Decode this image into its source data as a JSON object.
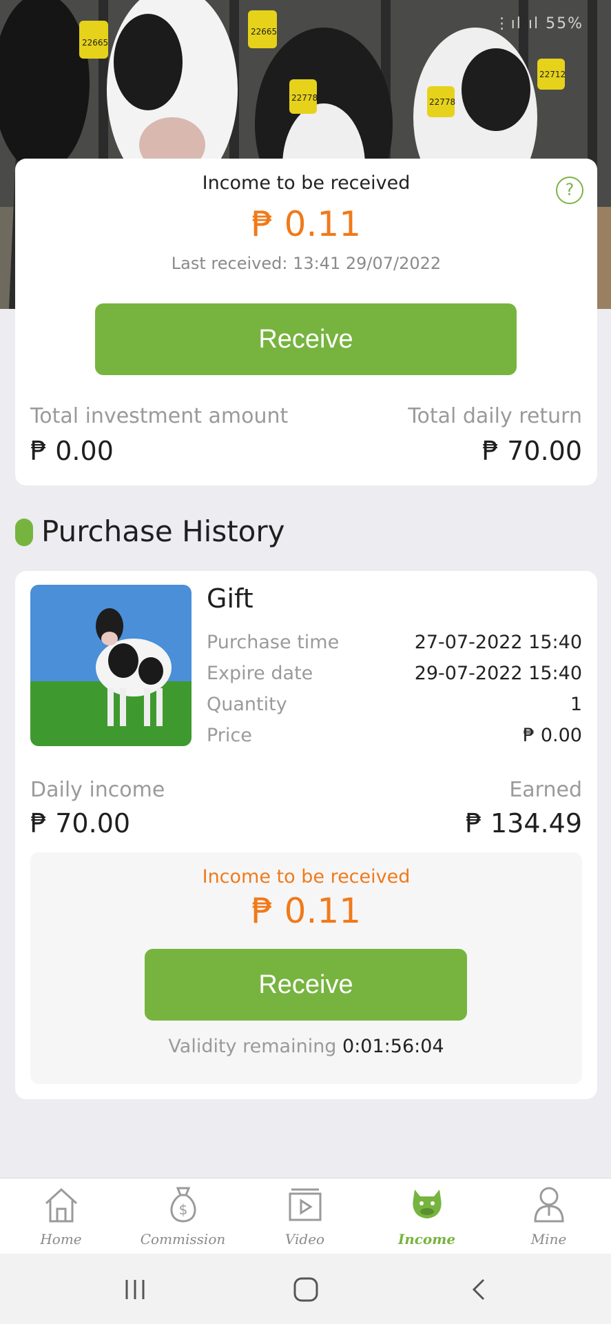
{
  "status_bar": {
    "glyphs": "⋮ıl ıl 55%"
  },
  "hero": {
    "ear_tags": [
      "22665",
      "22665",
      "22778",
      "22778",
      "22712"
    ]
  },
  "summary": {
    "title": "Income to be received",
    "amount": "₱ 0.11",
    "last_received": "Last received: 13:41 29/07/2022",
    "receive_label": "Receive",
    "total_investment_label": "Total investment amount",
    "total_investment_value": "₱ 0.00",
    "total_daily_return_label": "Total daily return",
    "total_daily_return_value": "₱ 70.00",
    "help_glyph": "?"
  },
  "purchase_history": {
    "title": "Purchase History",
    "items": [
      {
        "name": "Gift",
        "purchase_time_label": "Purchase time",
        "purchase_time": "27-07-2022 15:40",
        "expire_date_label": "Expire date",
        "expire_date": "29-07-2022 15:40",
        "quantity_label": "Quantity",
        "quantity": "1",
        "price_label": "Price",
        "price": "₱ 0.00",
        "daily_income_label": "Daily income",
        "daily_income": "₱ 70.00",
        "earned_label": "Earned",
        "earned": "₱ 134.49",
        "pending_title": "Income to be received",
        "pending_amount": "₱ 0.11",
        "receive_label": "Receive",
        "validity_label": "Validity remaining ",
        "validity_value": "0:01:56:04"
      }
    ]
  },
  "tabbar": {
    "tabs": [
      {
        "label": "Home",
        "icon": "home-icon"
      },
      {
        "label": "Commission",
        "icon": "money-bag-icon"
      },
      {
        "label": "Video",
        "icon": "video-icon"
      },
      {
        "label": "Income",
        "icon": "cow-icon",
        "active": true
      },
      {
        "label": "Mine",
        "icon": "person-icon"
      }
    ]
  },
  "colors": {
    "accent_green": "#77b43f",
    "accent_orange": "#f07a1a",
    "background": "#ececf1"
  }
}
